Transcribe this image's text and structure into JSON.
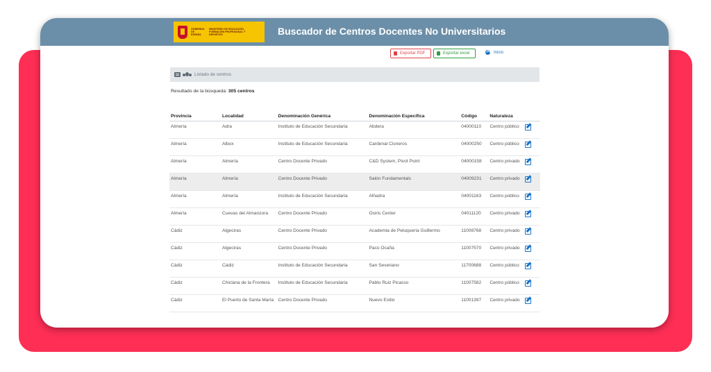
{
  "header": {
    "logo_gobierno": "GOBIERNO DE ESPAÑA",
    "logo_ministerio": "MINISTERIO DE EDUCACIÓN, FORMACIÓN PROFESIONAL Y DEPORTES",
    "title": "Buscador de Centros Docentes No Universitarios",
    "bar_color": "#6c8fa9",
    "logo_color": "#f6c400"
  },
  "actions": {
    "export_pdf": "Exportar PDF",
    "export_excel": "Exportar excel",
    "home": "Inicio"
  },
  "list": {
    "title": "Listado de centros",
    "result_label": "Resultado de la búsqueda:",
    "result_count": "305 centros"
  },
  "table": {
    "columns": [
      "Provincia",
      "Localidad",
      "Denominación Genérica",
      "Denominación Específica",
      "Código",
      "Naturaleza"
    ],
    "rows": [
      {
        "provincia": "Almería",
        "localidad": "Adra",
        "generica": "Instituto de Educación Secundaria",
        "especifica": "Abdera",
        "codigo": "04000110",
        "naturaleza": "Centro público"
      },
      {
        "provincia": "Almería",
        "localidad": "Albox",
        "generica": "Instituto de Educación Secundaria",
        "especifica": "Cardenal Cisneros",
        "codigo": "04000250",
        "naturaleza": "Centro público"
      },
      {
        "provincia": "Almería",
        "localidad": "Almería",
        "generica": "Centro Docente Privado",
        "especifica": "C&D System, Pivot Point",
        "codigo": "04000158",
        "naturaleza": "Centro privado"
      },
      {
        "provincia": "Almería",
        "localidad": "Almería",
        "generica": "Centro Docente Privado",
        "especifica": "Salón Fundamentals",
        "codigo": "04009231",
        "naturaleza": "Centro privado"
      },
      {
        "provincia": "Almería",
        "localidad": "Almería",
        "generica": "Instituto de Educación Secundaria",
        "especifica": "Alhadra",
        "codigo": "04001163",
        "naturaleza": "Centro público"
      },
      {
        "provincia": "Almería",
        "localidad": "Cuevas del Almanzora",
        "generica": "Centro Docente Privado",
        "especifica": "Osiris Center",
        "codigo": "04011120",
        "naturaleza": "Centro privado"
      },
      {
        "provincia": "Cádiz",
        "localidad": "Algeciras",
        "generica": "Centro Docente Privado",
        "especifica": "Academia de Peluquería Guillermo",
        "codigo": "11008768",
        "naturaleza": "Centro privado"
      },
      {
        "provincia": "Cádiz",
        "localidad": "Algeciras",
        "generica": "Centro Docente Privado",
        "especifica": "Paco Ocaña",
        "codigo": "11007570",
        "naturaleza": "Centro privado"
      },
      {
        "provincia": "Cádiz",
        "localidad": "Cádiz",
        "generica": "Instituto de Educación Secundaria",
        "especifica": "San Severiano",
        "codigo": "11700688",
        "naturaleza": "Centro público"
      },
      {
        "provincia": "Cádiz",
        "localidad": "Chiclana de la Frontera",
        "generica": "Instituto de Educación Secundaria",
        "especifica": "Pablo Ruiz Picasso",
        "codigo": "11007582",
        "naturaleza": "Centro público"
      },
      {
        "provincia": "Cádiz",
        "localidad": "El Puerto de Santa María",
        "generica": "Centro Docente Privado",
        "especifica": "Nuevo Estilo",
        "codigo": "11001397",
        "naturaleza": "Centro privado"
      }
    ]
  }
}
